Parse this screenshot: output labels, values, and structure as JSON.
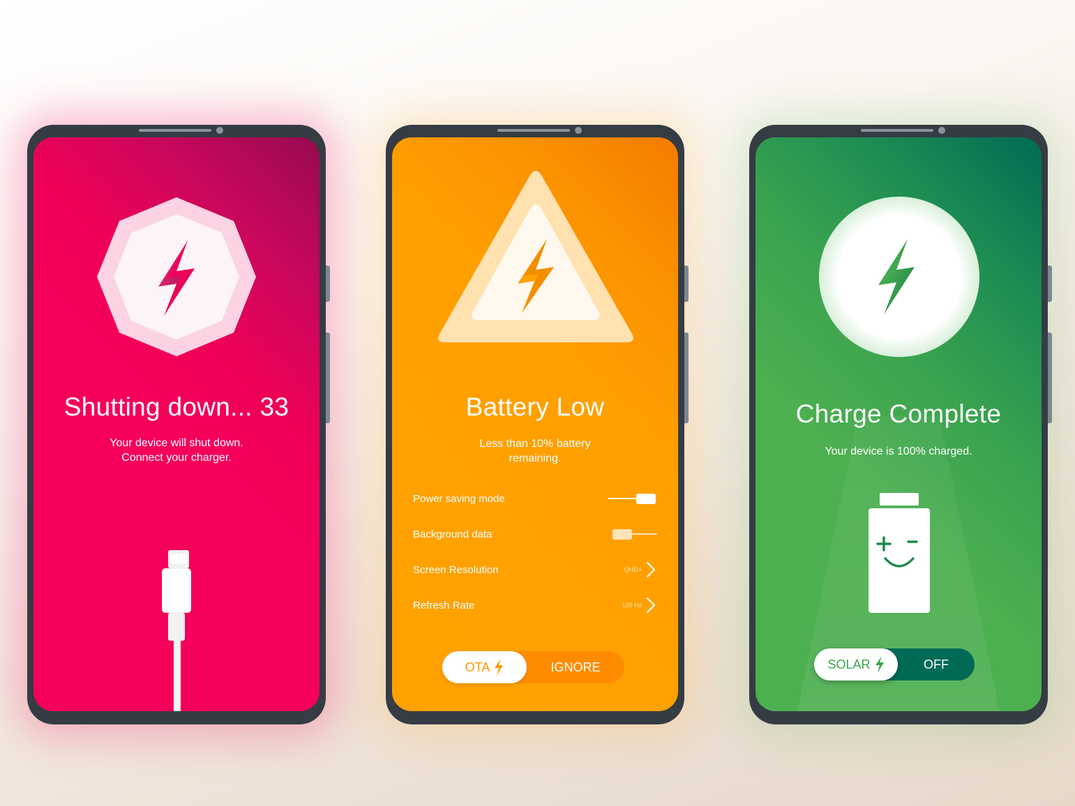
{
  "phones": {
    "red": {
      "title": "Shutting down... 33",
      "subtitle_line1": "Your device will shut down.",
      "subtitle_line2": "Connect your charger.",
      "icon": "bolt-icon",
      "accent": "#f5005a"
    },
    "orange": {
      "title": "Battery Low",
      "subtitle_line1": "Less than 10% battery",
      "subtitle_line2": "remaining.",
      "icon": "warning-bolt-icon",
      "accent": "#ffa000",
      "settings": [
        {
          "label": "Power saving mode",
          "control": "toggle",
          "on": true
        },
        {
          "label": "Background data",
          "control": "toggle",
          "on": false
        },
        {
          "label": "Screen Resolution",
          "value": "QHD+",
          "control": "chevron"
        },
        {
          "label": "Refresh Rate",
          "value": "120 Hz",
          "control": "chevron"
        }
      ],
      "pill": {
        "active_label": "OTA",
        "inactive_label": "IGNORE"
      }
    },
    "green": {
      "title": "Charge Complete",
      "subtitle": "Your device is 100% charged.",
      "icon": "bolt-icon",
      "accent": "#4caf50",
      "pill": {
        "active_label": "SOLAR",
        "inactive_label": "OFF"
      }
    }
  }
}
